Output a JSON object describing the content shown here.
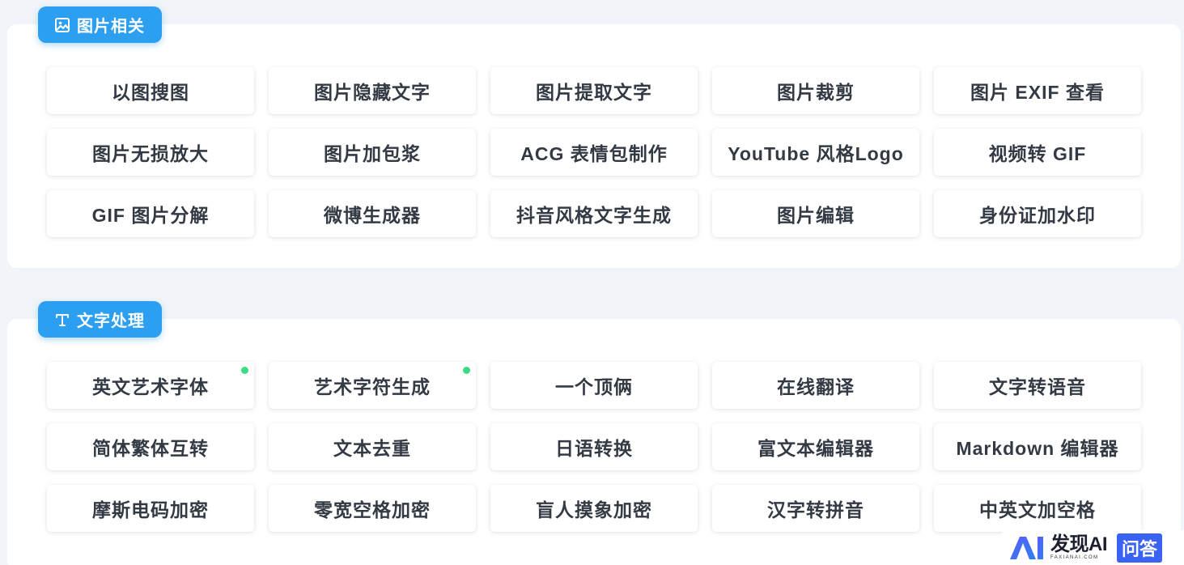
{
  "sections": [
    {
      "title": "图片相关",
      "icon": "image-icon",
      "tools": [
        {
          "label": "以图搜图"
        },
        {
          "label": "图片隐藏文字"
        },
        {
          "label": "图片提取文字"
        },
        {
          "label": "图片裁剪"
        },
        {
          "label": "图片 EXIF 查看"
        },
        {
          "label": "图片无损放大"
        },
        {
          "label": "图片加包浆"
        },
        {
          "label": "ACG 表情包制作"
        },
        {
          "label": "YouTube 风格Logo"
        },
        {
          "label": "视频转 GIF"
        },
        {
          "label": "GIF 图片分解"
        },
        {
          "label": "微博生成器"
        },
        {
          "label": "抖音风格文字生成"
        },
        {
          "label": "图片编辑"
        },
        {
          "label": "身份证加水印"
        }
      ]
    },
    {
      "title": "文字处理",
      "icon": "text-icon",
      "tools": [
        {
          "label": "英文艺术字体",
          "new": true
        },
        {
          "label": "艺术字符生成",
          "new": true
        },
        {
          "label": "一个顶俩"
        },
        {
          "label": "在线翻译"
        },
        {
          "label": "文字转语音"
        },
        {
          "label": "简体繁体互转"
        },
        {
          "label": "文本去重"
        },
        {
          "label": "日语转换"
        },
        {
          "label": "富文本编辑器"
        },
        {
          "label": "Markdown 编辑器"
        },
        {
          "label": "摩斯电码加密"
        },
        {
          "label": "零宽空格加密"
        },
        {
          "label": "盲人摸象加密"
        },
        {
          "label": "汉字转拼音"
        },
        {
          "label": "中英文加空格"
        }
      ]
    }
  ],
  "colors": {
    "accent": "#2c9ff0",
    "new_dot": "#3ddc84",
    "watermark_badge": "#3b63f3"
  },
  "watermark": {
    "name": "发现AI",
    "domain": "FAXIANAI.COM",
    "badge": "问答"
  }
}
